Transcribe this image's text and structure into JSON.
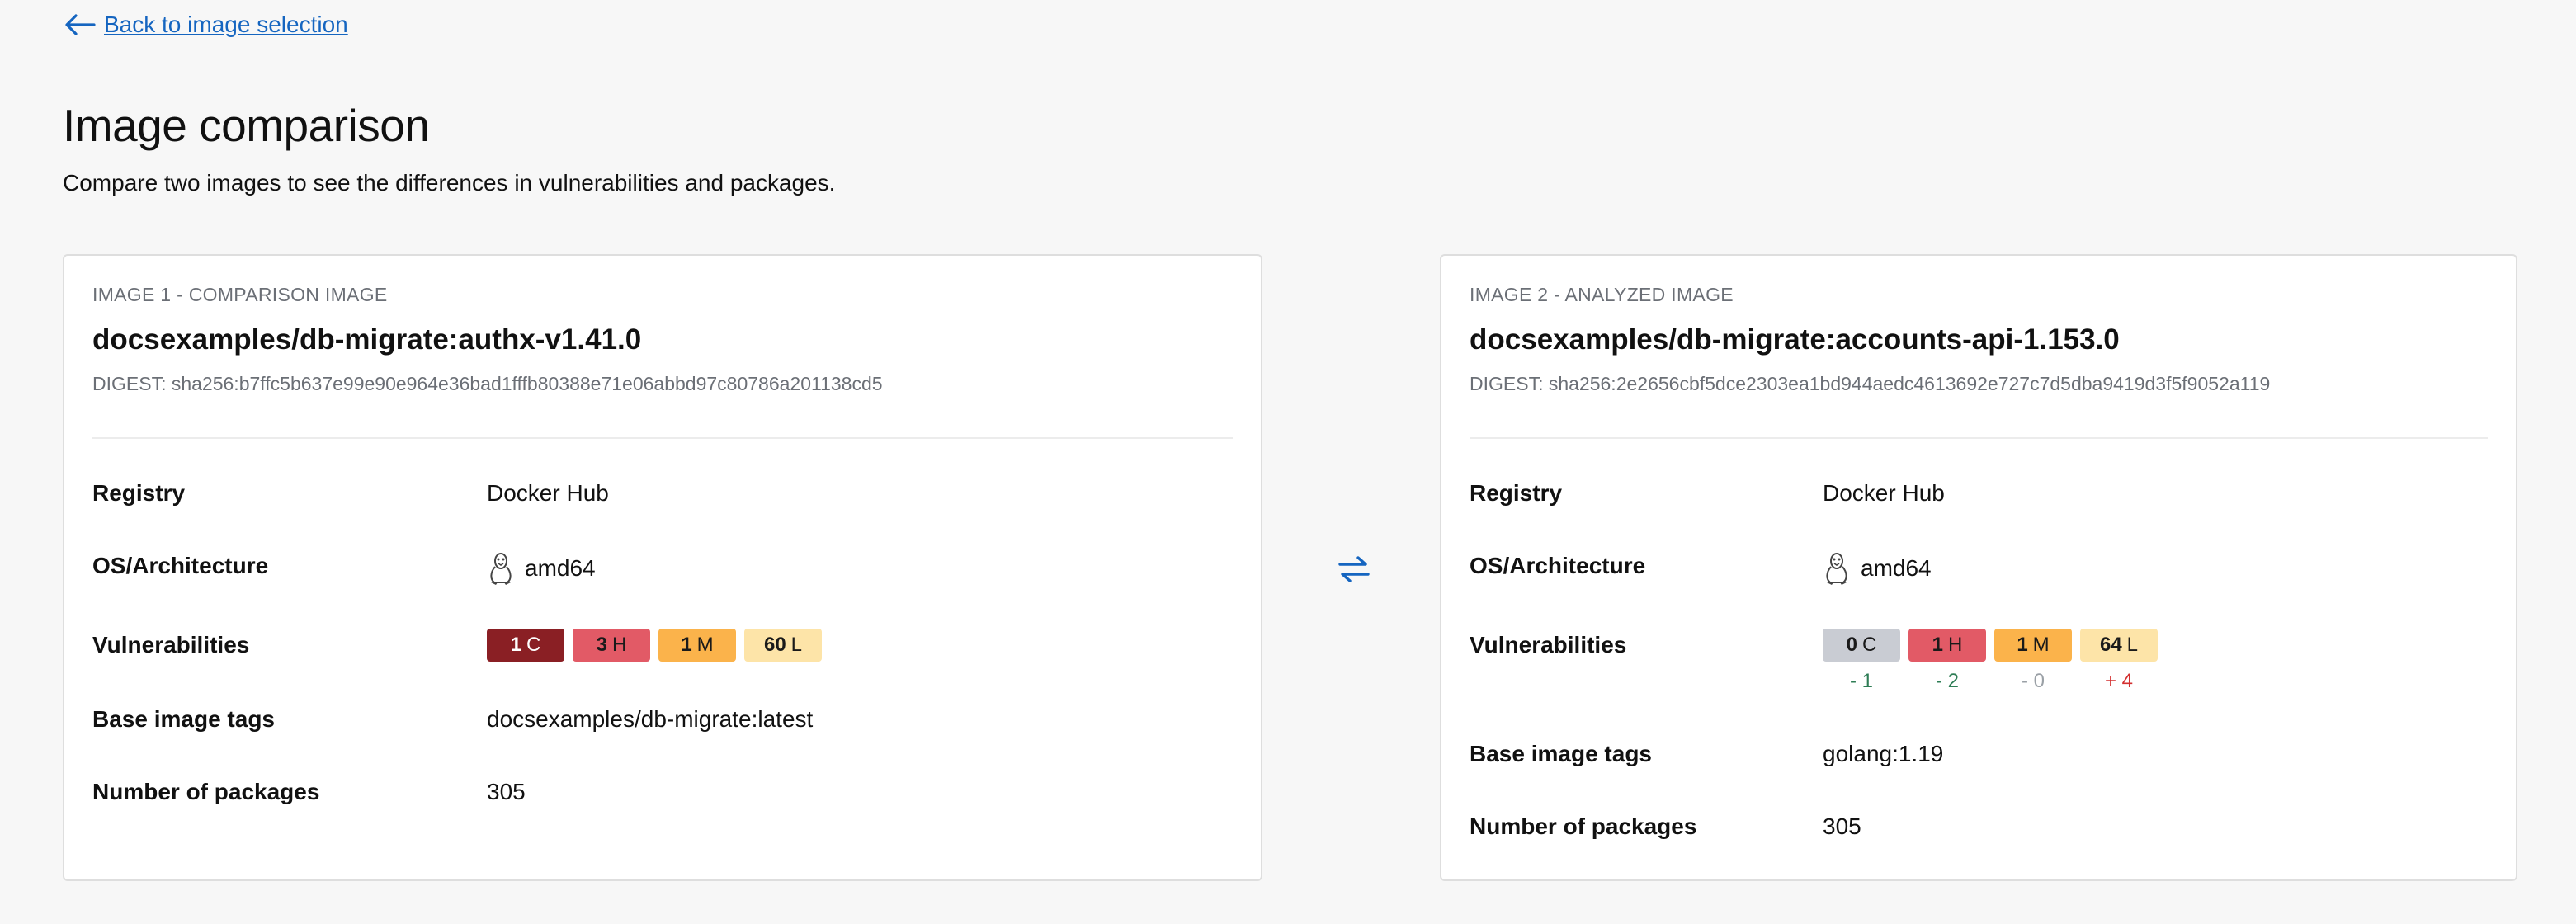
{
  "back_link": {
    "label": "Back to image selection"
  },
  "header": {
    "title": "Image comparison",
    "subtitle": "Compare two images to see the differences in vulnerabilities and packages."
  },
  "image1": {
    "eyebrow": "IMAGE 1 - COMPARISON IMAGE",
    "name": "docsexamples/db-migrate:authx-v1.41.0",
    "digest": "DIGEST: sha256:b7ffc5b637e99e90e964e36bad1fffb80388e71e06abbd97c80786a201138cd5",
    "labels": {
      "registry": "Registry",
      "os": "OS/Architecture",
      "vulns": "Vulnerabilities",
      "base_tags": "Base image tags",
      "packages": "Number of packages"
    },
    "registry": "Docker Hub",
    "os_icon": "linux-tux-icon",
    "architecture": "amd64",
    "vulnerabilities": {
      "critical": {
        "count": "1",
        "letter": "C"
      },
      "high": {
        "count": "3",
        "letter": "H"
      },
      "medium": {
        "count": "1",
        "letter": "M"
      },
      "low": {
        "count": "60",
        "letter": "L"
      }
    },
    "base_image_tags": "docsexamples/db-migrate:latest",
    "packages": "305"
  },
  "image2": {
    "eyebrow": "IMAGE 2 - ANALYZED IMAGE",
    "name": "docsexamples/db-migrate:accounts-api-1.153.0",
    "digest": "DIGEST: sha256:2e2656cbf5dce2303ea1bd944aedc4613692e727c7d5dba9419d3f5f9052a119",
    "labels": {
      "registry": "Registry",
      "os": "OS/Architecture",
      "vulns": "Vulnerabilities",
      "base_tags": "Base image tags",
      "packages": "Number of packages"
    },
    "registry": "Docker Hub",
    "os_icon": "linux-tux-icon",
    "architecture": "amd64",
    "vulnerabilities": {
      "critical": {
        "count": "0",
        "letter": "C",
        "delta": "- 1"
      },
      "high": {
        "count": "1",
        "letter": "H",
        "delta": "- 2"
      },
      "medium": {
        "count": "1",
        "letter": "M",
        "delta": "- 0"
      },
      "low": {
        "count": "64",
        "letter": "L",
        "delta": "+ 4"
      }
    },
    "base_image_tags": "golang:1.19",
    "packages": "305"
  },
  "colors": {
    "link": "#1565c0",
    "critical": "#8a1f24",
    "high": "#e25a66",
    "medium": "#fbb34b",
    "low": "#fde4a8",
    "zero": "#c9ccd3",
    "delta_decrease": "#2e7d55",
    "delta_increase": "#d32f2f",
    "delta_neutral": "#9aa0a6"
  },
  "swap_icon": "swap-arrows-icon"
}
